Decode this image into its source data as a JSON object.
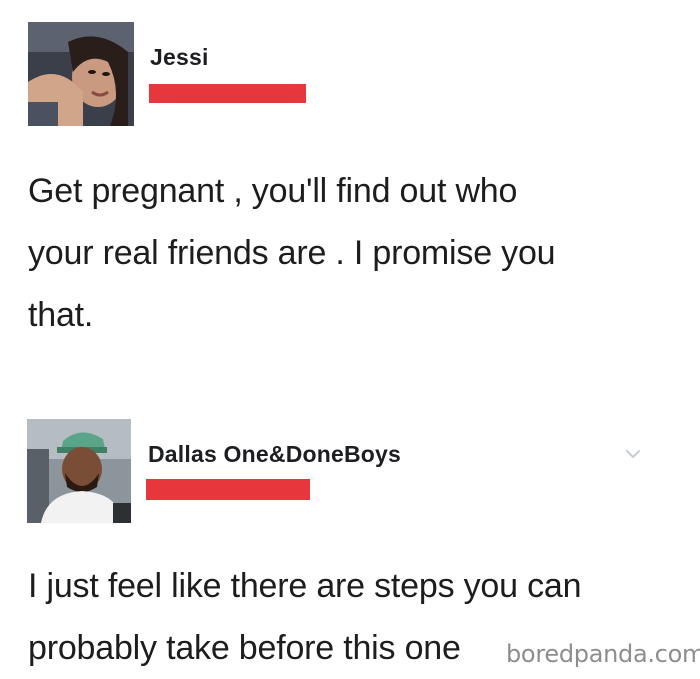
{
  "posts": [
    {
      "author": "Jessi",
      "avatar": "avatar-woman-selfie",
      "name_redacted": true,
      "body_lines": [
        "Get pregnant , you'll find out who",
        "your real friends are . I promise you",
        "that."
      ]
    },
    {
      "author": "Dallas One&DoneBoys",
      "avatar": "avatar-man-cap-car",
      "name_redacted": true,
      "menu_icon": "chevron-down-icon",
      "body_lines": [
        "I just feel like there are steps you can",
        "probably take before this one"
      ]
    }
  ],
  "watermark": "boredpanda.com",
  "colors": {
    "redaction": "#e8363d",
    "text": "#1d1d1d",
    "watermark": "#7a7a7a"
  }
}
